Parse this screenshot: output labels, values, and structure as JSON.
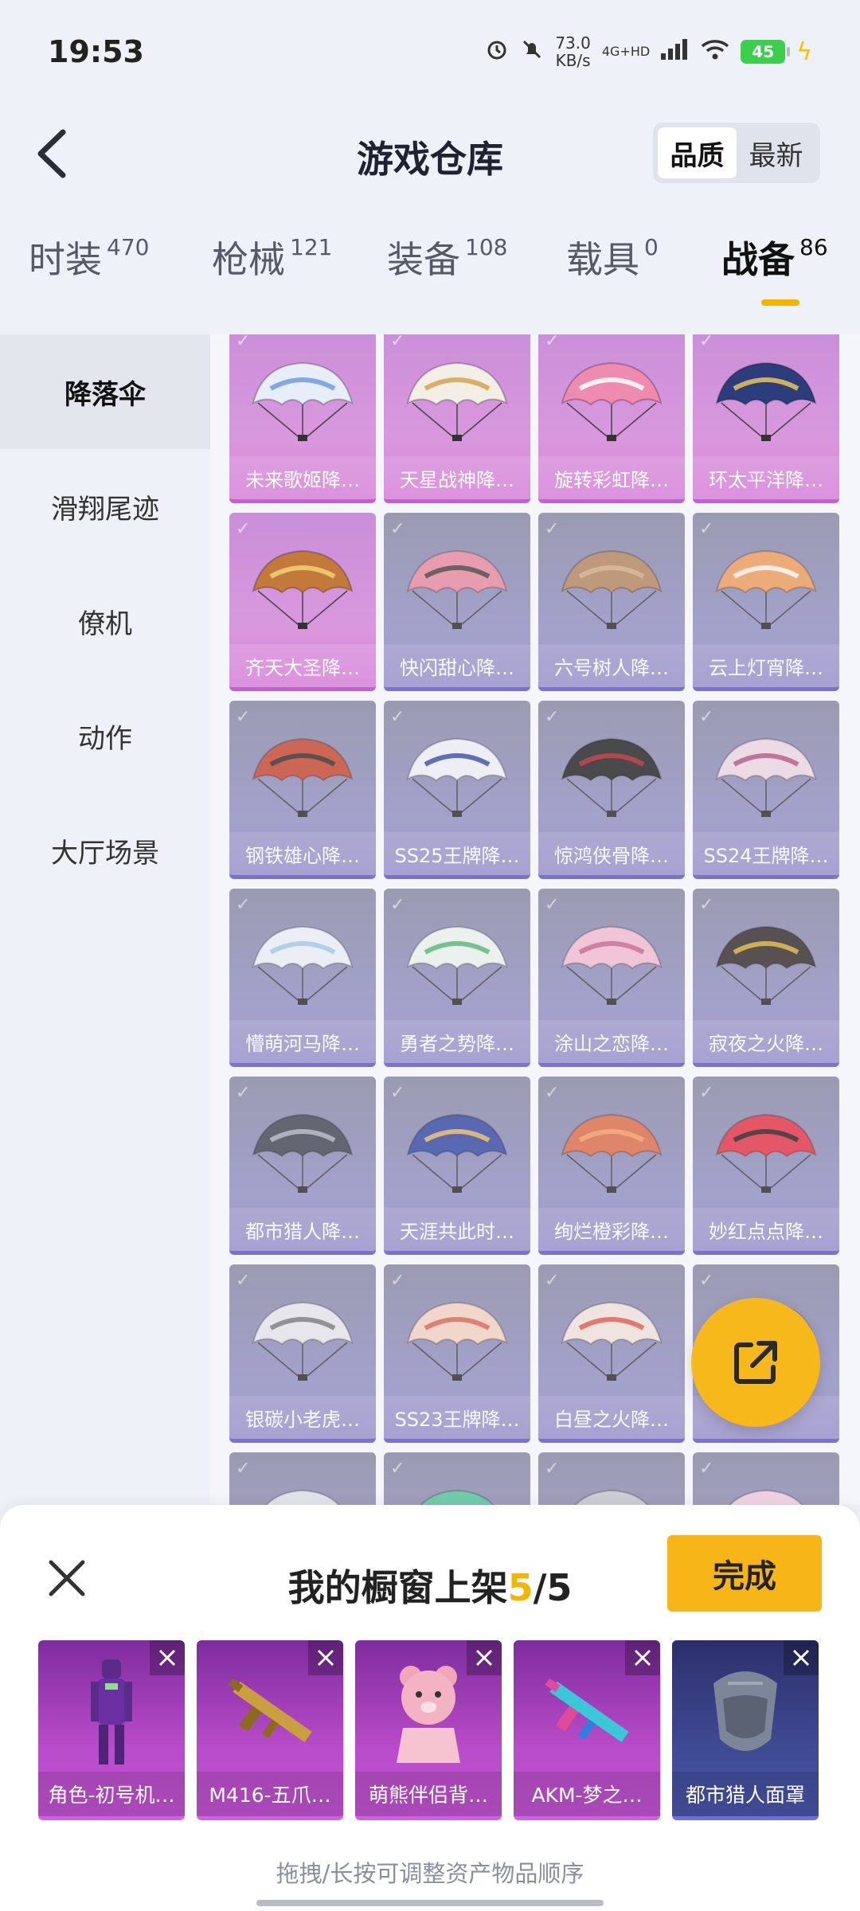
{
  "status_bar": {
    "time": "19:53",
    "speed_value": "73.0",
    "speed_unit": "KB/s",
    "network": "4G+HD",
    "battery": "45"
  },
  "header": {
    "title": "游戏仓库",
    "sort_options": [
      "品质",
      "最新"
    ],
    "active_sort": "品质"
  },
  "tabs": [
    {
      "label": "时装",
      "count": "470"
    },
    {
      "label": "枪械",
      "count": "121"
    },
    {
      "label": "装备",
      "count": "108"
    },
    {
      "label": "载具",
      "count": "0"
    },
    {
      "label": "战备",
      "count": "86",
      "active": true
    }
  ],
  "sidebar": {
    "items": [
      "降落伞",
      "滑翔尾迹",
      "僚机",
      "动作",
      "大厅场景"
    ],
    "active_index": 0
  },
  "grid": {
    "items": [
      {
        "name": "未来歌姬降…",
        "tier": "purple",
        "canopy": "#e8eef8",
        "accent": "#6e9be0"
      },
      {
        "name": "天星战神降…",
        "tier": "purple",
        "canopy": "#f3efe6",
        "accent": "#d2a34e"
      },
      {
        "name": "旋转彩虹降…",
        "tier": "purple",
        "canopy": "#f08bb0",
        "accent": "#ffffff"
      },
      {
        "name": "环太平洋降…",
        "tier": "purple",
        "canopy": "#2b3d7a",
        "accent": "#e7c45a"
      },
      {
        "name": "齐天大圣降…",
        "tier": "purple",
        "canopy": "#c2793a",
        "accent": "#f1d27a"
      },
      {
        "name": "快闪甜心降…",
        "tier": "blue",
        "canopy": "#e98fa3",
        "accent": "#3a3a3a"
      },
      {
        "name": "六号树人降…",
        "tier": "blue",
        "canopy": "#b98a63",
        "accent": "#d7b48c"
      },
      {
        "name": "云上灯宵降…",
        "tier": "blue",
        "canopy": "#f0a060",
        "accent": "#ffffff"
      },
      {
        "name": "钢铁雄心降…",
        "tier": "blue",
        "canopy": "#c94d36",
        "accent": "#2d2d2d"
      },
      {
        "name": "SS25王牌降…",
        "tier": "blue",
        "canopy": "#f2f2f8",
        "accent": "#283b9a"
      },
      {
        "name": "惊鸿侠骨降…",
        "tier": "blue",
        "canopy": "#2a2a2a",
        "accent": "#c0282d"
      },
      {
        "name": "SS24王牌降…",
        "tier": "blue",
        "canopy": "#f0d9e4",
        "accent": "#b04a78"
      },
      {
        "name": "懵萌河马降…",
        "tier": "blue",
        "canopy": "#eef3f8",
        "accent": "#9ec6e8"
      },
      {
        "name": "勇者之势降…",
        "tier": "blue",
        "canopy": "#eef6ee",
        "accent": "#48b06a"
      },
      {
        "name": "涂山之恋降…",
        "tier": "blue",
        "canopy": "#f5c0d4",
        "accent": "#c45d8a"
      },
      {
        "name": "寂夜之火降…",
        "tier": "blue",
        "canopy": "#3a3430",
        "accent": "#e9b838"
      },
      {
        "name": "都市猎人降…",
        "tier": "blue",
        "canopy": "#4a4d58",
        "accent": "#b7b9c6"
      },
      {
        "name": "天涯共此时…",
        "tier": "blue",
        "canopy": "#3b4fa5",
        "accent": "#f3c063"
      },
      {
        "name": "绚烂橙彩降…",
        "tier": "blue",
        "canopy": "#e0724e",
        "accent": "#f4a56a"
      },
      {
        "name": "妙红点点降…",
        "tier": "blue",
        "canopy": "#e43a4a",
        "accent": "#1f1f1f"
      },
      {
        "name": "银碳小老虎…",
        "tier": "blue",
        "canopy": "#eaeaec",
        "accent": "#6d6d72"
      },
      {
        "name": "SS23王牌降…",
        "tier": "blue",
        "canopy": "#f6d6c4",
        "accent": "#d65a4a"
      },
      {
        "name": "白昼之火降…",
        "tier": "blue",
        "canopy": "#f3e6df",
        "accent": "#e04a3a"
      },
      {
        "name": "",
        "tier": "blue",
        "canopy": "#f7ecb5",
        "accent": "#e8c76a"
      },
      {
        "name": "",
        "tier": "blue",
        "canopy": "#e0e6ea",
        "accent": "#a6b0b6"
      },
      {
        "name": "",
        "tier": "blue",
        "canopy": "#5ac89e",
        "accent": "#2c7e5e"
      },
      {
        "name": "",
        "tier": "blue",
        "canopy": "#c9c9d1",
        "accent": "#888"
      },
      {
        "name": "",
        "tier": "blue",
        "canopy": "#f4cfe0",
        "accent": "#c27a9c"
      }
    ]
  },
  "fab": {
    "icon": "share-icon"
  },
  "sheet": {
    "title_prefix": "我的橱窗上架",
    "current": "5",
    "separator": "/",
    "total": "5",
    "done_label": "完成",
    "items": [
      {
        "name": "角色-初号机…",
        "tier": "purple",
        "icon": "eva-unit-01-figure"
      },
      {
        "name": "M416-五爪…",
        "tier": "purple",
        "icon": "golden-rifle"
      },
      {
        "name": "萌熊伴侣背…",
        "tier": "purple",
        "icon": "pink-bear-backpack"
      },
      {
        "name": "AKM-梦之…",
        "tier": "purple",
        "icon": "pink-rifle"
      },
      {
        "name": "都市猎人面罩",
        "tier": "blue",
        "icon": "grey-mask"
      }
    ],
    "hint": "拖拽/长按可调整资产物品顺序"
  },
  "colors": {
    "accent": "#f5b400",
    "card_purple": "#d998dd",
    "card_blue": "#9795c6"
  }
}
